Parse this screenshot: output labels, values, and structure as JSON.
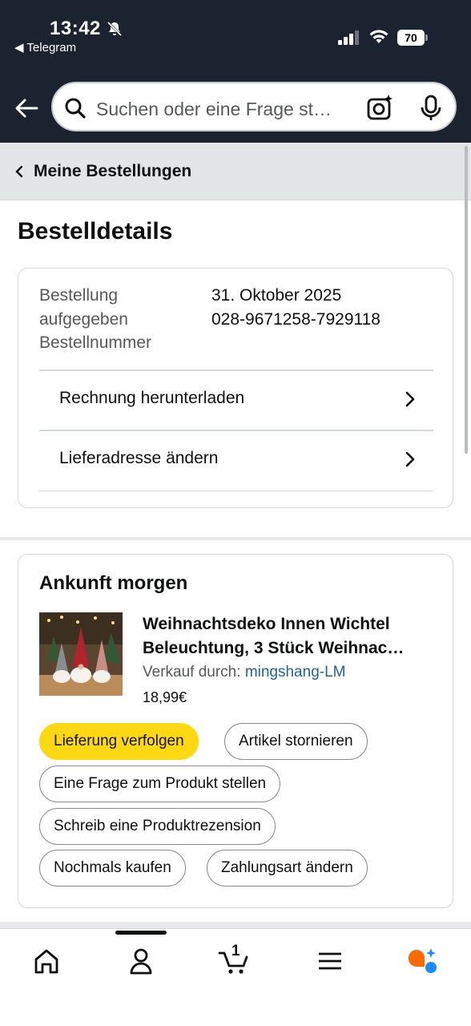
{
  "status_bar": {
    "time": "13:42",
    "back_app": "◀ Telegram",
    "battery": "70"
  },
  "search": {
    "placeholder": "Suchen oder eine Frage st…"
  },
  "breadcrumb": {
    "label": "Meine Bestellungen"
  },
  "page": {
    "title": "Bestelldetails"
  },
  "order": {
    "placed_label_1": "Bestellung",
    "placed_label_2": "aufgegeben",
    "number_label": "Bestellnummer",
    "date": "31. Oktober 2025",
    "number": "028-9671258-7929118",
    "links": [
      {
        "label": "Rechnung herunterladen"
      },
      {
        "label": "Lieferadresse ändern"
      }
    ]
  },
  "delivery": {
    "heading": "Ankunft morgen",
    "product": {
      "title_line1": "Weihnachtsdeko Innen Wichtel",
      "title_line2": "Beleuchtung, 3 Stück Weihnac…",
      "seller_label": "Verkauf durch:",
      "seller": "mingshang-LM",
      "price": "18,99€"
    },
    "actions": {
      "track": "Lieferung verfolgen",
      "cancel": "Artikel stornieren",
      "question": "Eine Frage zum Produkt stellen",
      "review": "Schreib eine Produktrezension",
      "rebuy": "Nochmals kaufen",
      "payment": "Zahlungsart ändern"
    }
  },
  "nav": {
    "cart_count": "1",
    "items": [
      "home-icon",
      "account-icon",
      "cart-icon",
      "menu-icon",
      "rufus-icon"
    ]
  },
  "colors": {
    "header_bg": "#1b2330",
    "primary_button": "#ffd814",
    "link": "#2162a1"
  }
}
